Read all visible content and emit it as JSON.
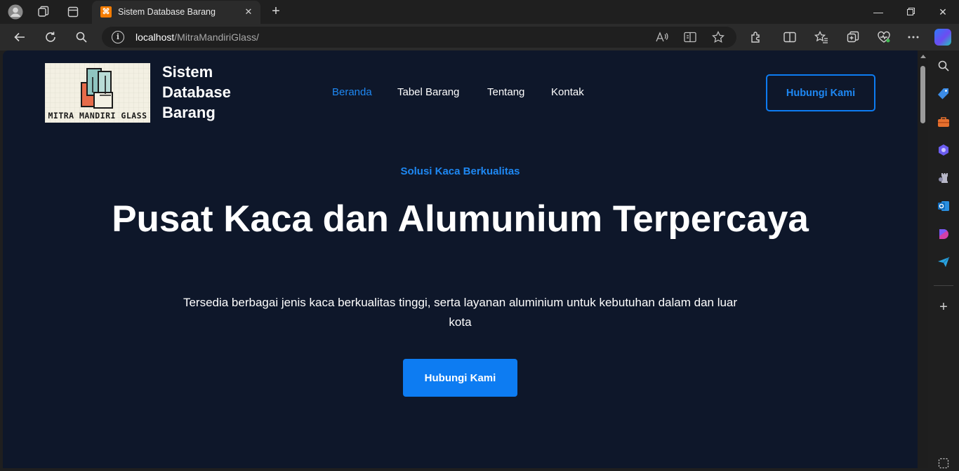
{
  "browser": {
    "tab_title": "Sistem Database Barang",
    "favicon_glyph": "⌘",
    "address_host": "localhost",
    "address_path": "/MitraMandiriGlass/",
    "accent_color": "#0d7cf2"
  },
  "site": {
    "logo_text": "MITRA MANDIRI GLASS",
    "brand_name": "Sistem Database Barang",
    "nav": [
      {
        "label": "Beranda",
        "active": true
      },
      {
        "label": "Tabel Barang",
        "active": false
      },
      {
        "label": "Tentang",
        "active": false
      },
      {
        "label": "Kontak",
        "active": false
      }
    ],
    "header_cta": "Hubungi Kami"
  },
  "hero": {
    "eyebrow": "Solusi Kaca Berkualitas",
    "headline": "Pusat Kaca dan Alumunium Terpercaya",
    "subtitle": "Tersedia berbagai jenis kaca berkualitas tinggi, serta layanan aluminium untuk kebutuhan dalam dan luar kota",
    "cta": "Hubungi Kami"
  }
}
